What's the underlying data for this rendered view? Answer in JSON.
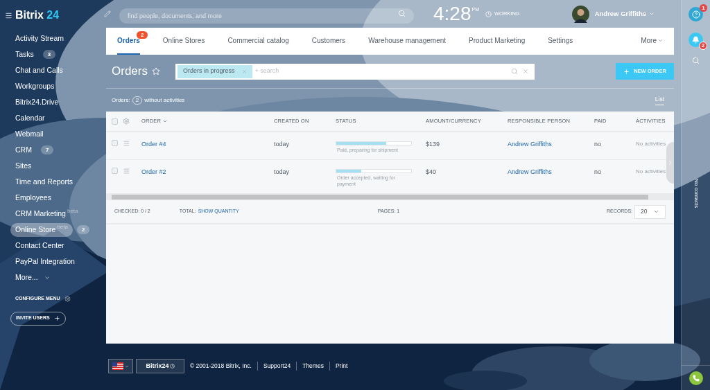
{
  "logo": {
    "name": "Bitrix",
    "suffix": "24"
  },
  "search": {
    "placeholder": "find people, documents, and more"
  },
  "clock": {
    "time": "4:28",
    "ampm": "PM",
    "status": "WORKING"
  },
  "user": {
    "name": "Andrew Griffiths"
  },
  "sidebar": {
    "items": [
      {
        "label": "Activity Stream",
        "selected": false
      },
      {
        "label": "Tasks",
        "badge": "3",
        "selected": false
      },
      {
        "label": "Chat and Calls",
        "selected": false
      },
      {
        "label": "Workgroups",
        "selected": false
      },
      {
        "label": "Bitrix24.Drive",
        "selected": false
      },
      {
        "label": "Calendar",
        "selected": false
      },
      {
        "label": "Webmail",
        "selected": false
      },
      {
        "label": "CRM",
        "badge": "7",
        "selected": false
      },
      {
        "label": "Sites",
        "selected": false
      },
      {
        "label": "Time and Reports",
        "selected": false
      },
      {
        "label": "Employees",
        "selected": false
      },
      {
        "label": "CRM Marketing",
        "tag": "beta",
        "selected": false
      },
      {
        "label": "Online Store",
        "tag": "beta",
        "badge": "2",
        "selected": true
      },
      {
        "label": "Contact Center",
        "selected": false
      },
      {
        "label": "PayPal Integration",
        "selected": false
      },
      {
        "label": "More...",
        "selected": false
      }
    ],
    "configure": "CONFIGURE MENU",
    "invite": "INVITE USERS"
  },
  "tabs": [
    {
      "label": "Orders",
      "badge": "2",
      "selected": true
    },
    {
      "label": "Online Stores",
      "selected": false
    },
    {
      "label": "Commercial catalog",
      "selected": false
    },
    {
      "label": "Customers",
      "selected": false
    },
    {
      "label": "Warehouse management",
      "selected": false
    },
    {
      "label": "Product Marketing",
      "selected": false
    },
    {
      "label": "Settings",
      "selected": false
    },
    {
      "label": "More",
      "selected": false
    }
  ],
  "page_title": "Orders",
  "filter": {
    "chip": "Orders in progress",
    "placeholder": "+ search"
  },
  "new_order": "NEW ORDER",
  "summary": {
    "label": "Orders:",
    "count": "2",
    "text": "without activities"
  },
  "view": "List",
  "table": {
    "all_checked": false,
    "columns": [
      "ORDER",
      "CREATED ON",
      "STATUS",
      "AMOUNT/CURRENCY",
      "RESPONSIBLE PERSON",
      "PAID",
      "ACTIVITIES"
    ],
    "rows": [
      {
        "order": "Order #4",
        "created": "today",
        "level": 0.67,
        "status": "Paid, preparing for shipment",
        "amount": "$139",
        "person": "Andrew Griffiths",
        "paid": "no",
        "activities": "No activities",
        "checked": false
      },
      {
        "order": "Order #2",
        "created": "today",
        "level": 0.33,
        "status": "Order accepted, waiting for payment",
        "amount": "$40",
        "person": "Andrew Griffiths",
        "paid": "no",
        "activities": "No activities",
        "checked": false
      }
    ]
  },
  "table_footer": {
    "checked_label": "CHECKED:",
    "checked": "0 / 2",
    "total_label": "TOTAL:",
    "total_link": "SHOW QUANTITY",
    "pages_label": "PAGES:",
    "pages": "1",
    "records_label": "RECORDS:",
    "records": "20"
  },
  "right_panel": {
    "help_badge": "1",
    "bell_badge": "2",
    "contacts": "No contacts"
  },
  "footer": {
    "brand": "Bitrix24",
    "copyright": "© 2001-2018 Bitrix, Inc.",
    "links": [
      "Support24",
      "Themes",
      "Print"
    ]
  }
}
